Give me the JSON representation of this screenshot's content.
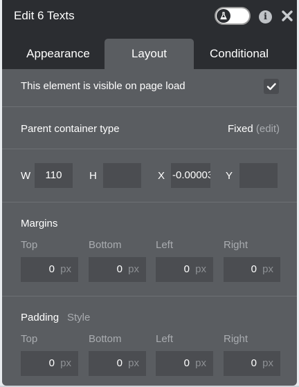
{
  "header": {
    "title": "Edit 6 Texts",
    "toggle_icon": "flask-icon",
    "info_icon": "info-icon",
    "close_icon": "close-icon"
  },
  "tabs": [
    {
      "label": "Appearance",
      "active": false
    },
    {
      "label": "Layout",
      "active": true
    },
    {
      "label": "Conditional",
      "active": false
    }
  ],
  "visible_on_load": {
    "label": "This element is visible on page load",
    "checked": true
  },
  "parent_container": {
    "label": "Parent container type",
    "value": "Fixed",
    "edit_label": "(edit)"
  },
  "dimensions": {
    "w_label": "W",
    "w_value": "110",
    "h_label": "H",
    "h_value": "",
    "x_label": "X",
    "x_value": "-0.00003",
    "y_label": "Y",
    "y_value": ""
  },
  "margins": {
    "title": "Margins",
    "fields": [
      {
        "label": "Top",
        "value": "0",
        "unit": "px"
      },
      {
        "label": "Bottom",
        "value": "0",
        "unit": "px"
      },
      {
        "label": "Left",
        "value": "0",
        "unit": "px"
      },
      {
        "label": "Right",
        "value": "0",
        "unit": "px"
      }
    ]
  },
  "padding": {
    "title": "Padding",
    "style_label": "Style",
    "fields": [
      {
        "label": "Top",
        "value": "0",
        "unit": "px"
      },
      {
        "label": "Bottom",
        "value": "0",
        "unit": "px"
      },
      {
        "label": "Left",
        "value": "0",
        "unit": "px"
      },
      {
        "label": "Right",
        "value": "0",
        "unit": "px"
      }
    ]
  },
  "colors": {
    "header_bg": "#2b2d31",
    "panel_bg": "#5a5d61",
    "field_bg": "#4b4d51"
  }
}
